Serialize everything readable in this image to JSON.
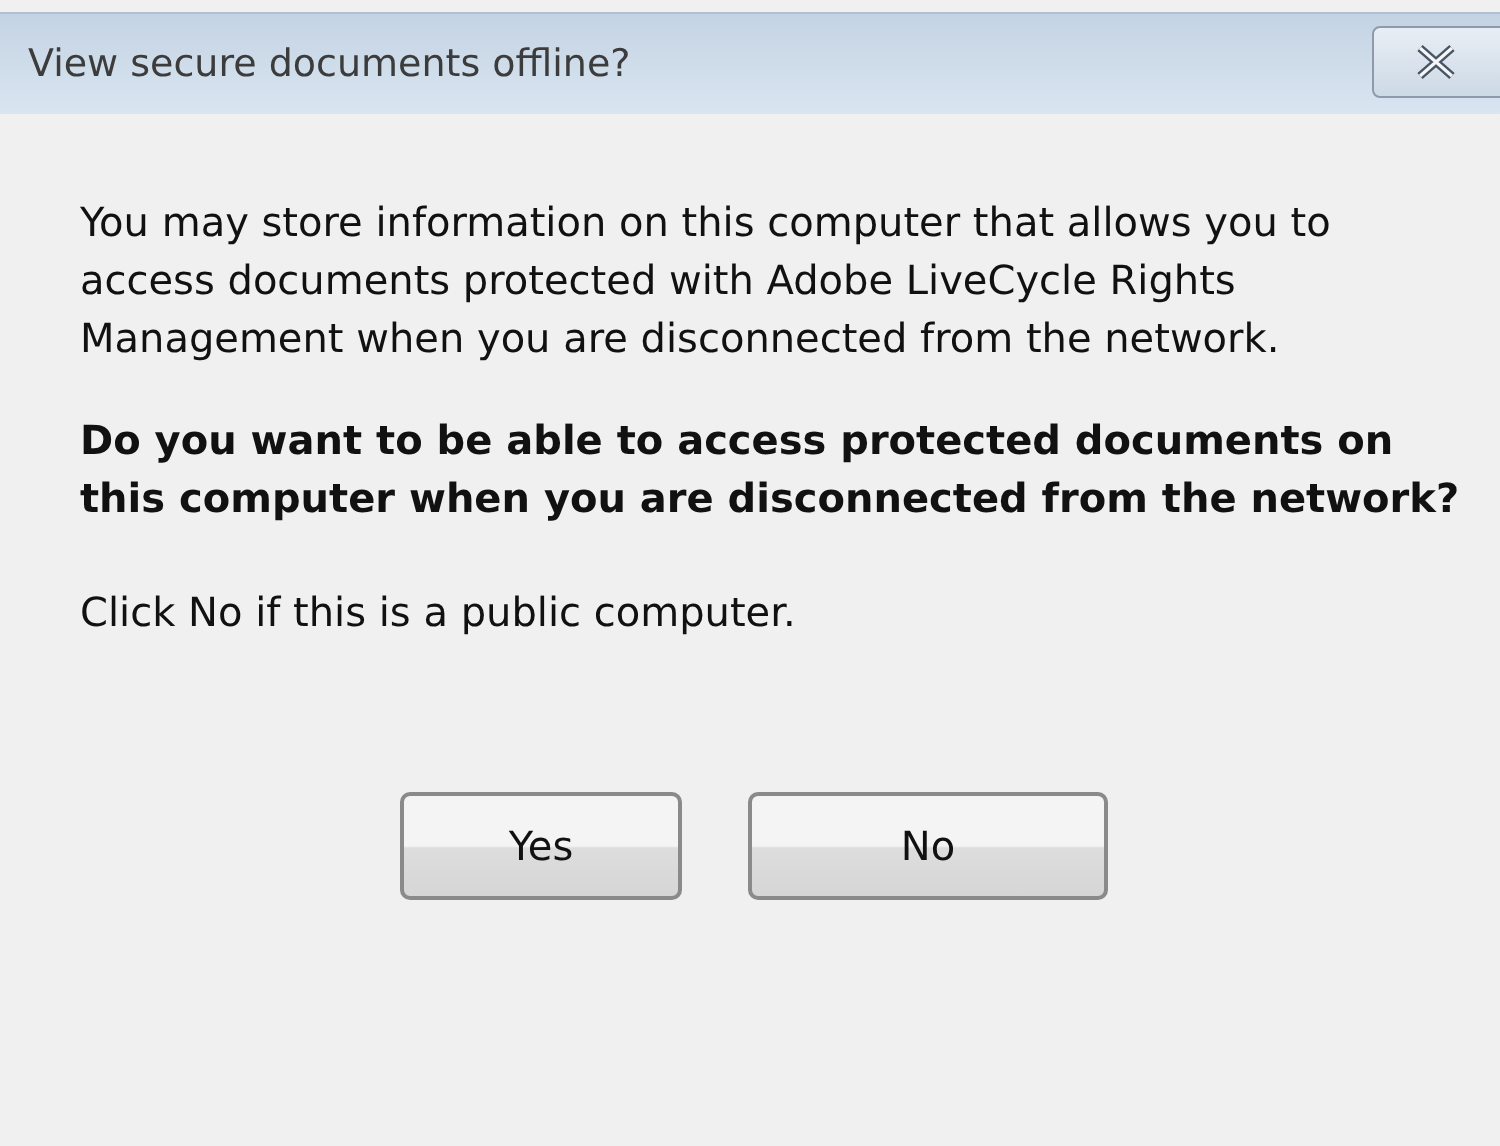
{
  "window": {
    "title": "View secure documents offline?"
  },
  "message": "You may store information on this computer that allows you to access documents protected with Adobe LiveCycle Rights Management when you are disconnected from the network.",
  "question": "Do you want to be able to access protected documents on this computer when you are disconnected from the network?",
  "note": "Click No if this is a public computer.",
  "buttons": [
    {
      "label": "Yes"
    },
    {
      "label": "No"
    }
  ]
}
